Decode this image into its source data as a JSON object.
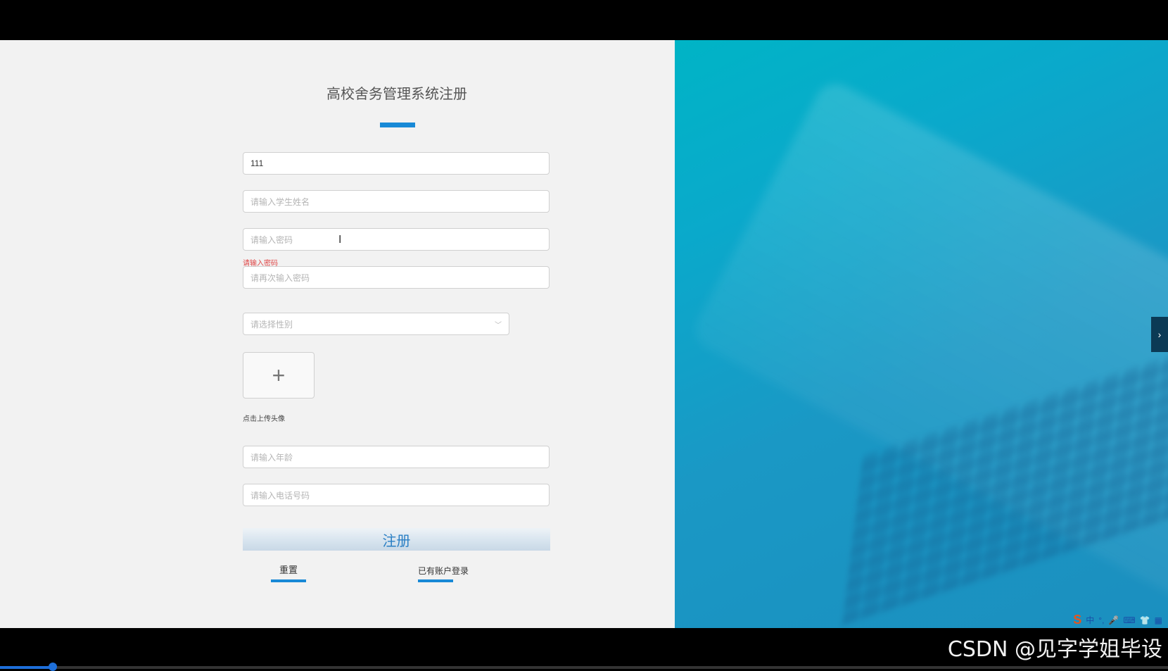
{
  "page": {
    "title": "高校舍务管理系统注册",
    "accent_color": "#1889d6"
  },
  "form": {
    "username": {
      "value": "111",
      "placeholder": ""
    },
    "student_name": {
      "value": "",
      "placeholder": "请输入学生姓名"
    },
    "password": {
      "value": "",
      "placeholder": "请输入密码",
      "error": "请输入密码"
    },
    "confirm_password": {
      "value": "",
      "placeholder": "请再次输入密码"
    },
    "gender": {
      "value": "",
      "placeholder": "请选择性别"
    },
    "avatar": {
      "upload_icon": "plus-icon",
      "label": "点击上传头像"
    },
    "age": {
      "value": "",
      "placeholder": "请输入年龄"
    },
    "phone": {
      "value": "",
      "placeholder": "请输入电话号码"
    },
    "submit_label": "注册",
    "reset_label": "重置",
    "login_link_label": "已有账户登录"
  },
  "right_panel": {
    "background_color": "#0aa9cb",
    "side_tab_icon": "chevron-right-icon"
  },
  "system_tray": {
    "ime_logo": "S",
    "items": [
      "中",
      "°,",
      "🎤",
      "⌨",
      "👕",
      "▦"
    ]
  },
  "video_overlay": {
    "watermark": "CSDN @见字学姐毕设",
    "progress": 0.045
  }
}
